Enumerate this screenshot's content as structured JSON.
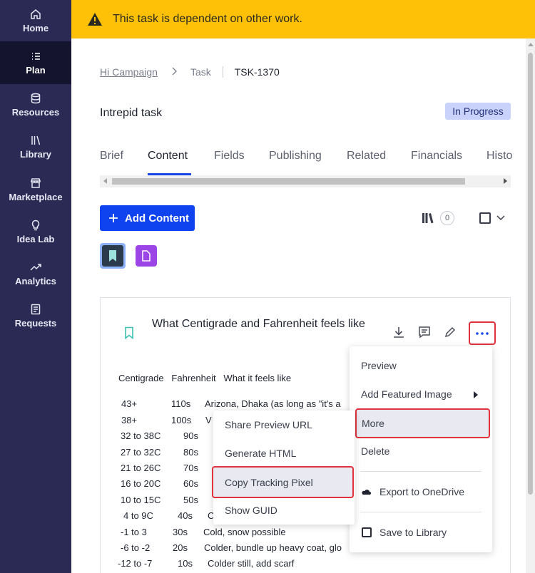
{
  "sidebar": {
    "items": [
      {
        "label": "Home",
        "icon": "home-icon"
      },
      {
        "label": "Plan",
        "icon": "list-icon",
        "active": true
      },
      {
        "label": "Resources",
        "icon": "database-icon"
      },
      {
        "label": "Library",
        "icon": "library-icon"
      },
      {
        "label": "Marketplace",
        "icon": "store-icon"
      },
      {
        "label": "Idea Lab",
        "icon": "lightbulb-icon"
      },
      {
        "label": "Analytics",
        "icon": "trend-icon"
      },
      {
        "label": "Requests",
        "icon": "document-icon"
      }
    ]
  },
  "banner": {
    "text": "This task is dependent on other work.",
    "color": "#ffc107"
  },
  "breadcrumb": {
    "campaign": "Hi Campaign",
    "task": "Task",
    "id": "TSK-1370"
  },
  "page": {
    "title": "Intrepid task",
    "status": "In Progress"
  },
  "tabs": [
    "Brief",
    "Content",
    "Fields",
    "Publishing",
    "Related",
    "Financials",
    "History"
  ],
  "active_tab": "Content",
  "toolbar": {
    "add_content": "Add Content",
    "library_count": "0"
  },
  "card": {
    "title": "What Centigrade and Fahrenheit feels like",
    "header_row": "Centigrade   Fahrenheit   What it feels like",
    "rows": [
      {
        "c": "43+",
        "f": "110s",
        "t": "Arizona, Dhaka (as long as \"it's a"
      },
      {
        "c": "38+",
        "f": "100s",
        "t": "V"
      },
      {
        "c": "32 to 38C",
        "f": "90s",
        "t": ""
      },
      {
        "c": "27 to 32C",
        "f": "80s",
        "t": ""
      },
      {
        "c": "21 to 26C",
        "f": "70s",
        "t": ""
      },
      {
        "c": "16 to 20C",
        "f": "60s",
        "t": ""
      },
      {
        "c": "10 to 15C",
        "f": "50s",
        "t": ""
      },
      {
        "c": "4 to 9C",
        "f": "40s",
        "t": "C"
      },
      {
        "c": "-1 to 3",
        "f": "30s",
        "t": "Cold, snow possible"
      },
      {
        "c": "-6 to -2",
        "f": "20s",
        "t": "Colder, bundle up heavy coat, glo"
      },
      {
        "c": "-12 to -7",
        "f": "10s",
        "t": "Colder still, add scarf"
      }
    ]
  },
  "menu_main": {
    "preview": "Preview",
    "add_featured_image": "Add Featured Image",
    "more": "More",
    "delete": "Delete",
    "export_onedrive": "Export to OneDrive",
    "save_library": "Save to Library"
  },
  "menu_sub": {
    "share_preview": "Share Preview URL",
    "generate_html": "Generate HTML",
    "copy_tracking": "Copy Tracking Pixel",
    "show_guid": "Show GUID"
  },
  "colors": {
    "accent": "#1043f0",
    "highlight": "#e0323c",
    "sidebar": "#2b2a55"
  }
}
